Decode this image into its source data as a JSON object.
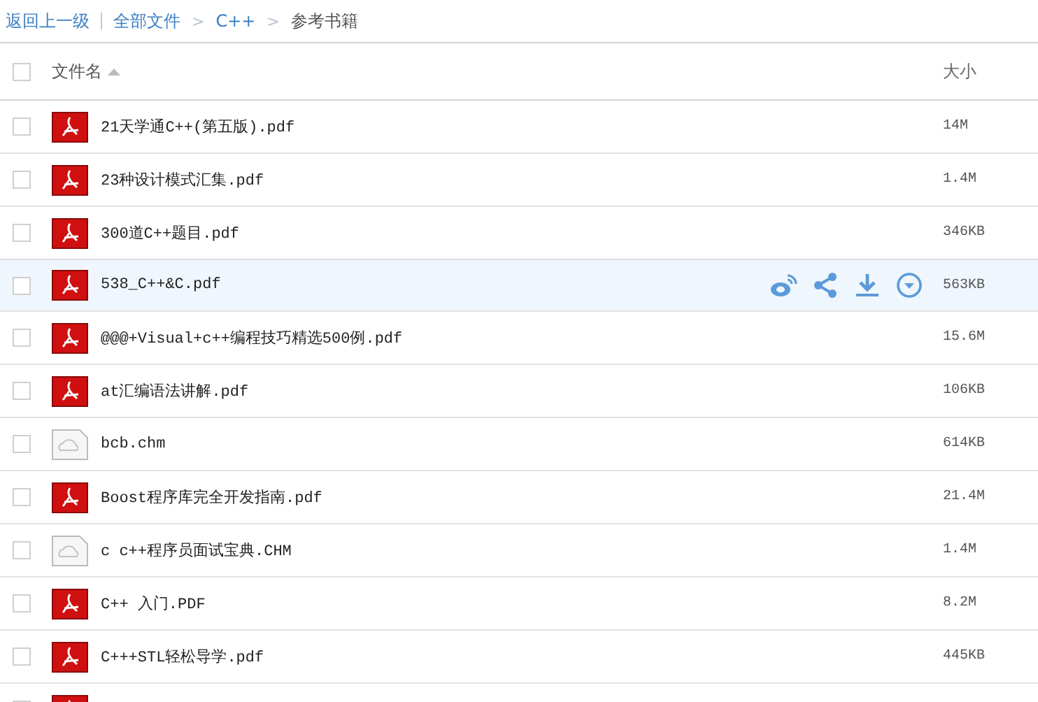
{
  "breadcrumb": {
    "back": "返回上一级",
    "items": [
      {
        "label": "全部文件",
        "current": false
      },
      {
        "label": "C++",
        "current": false
      },
      {
        "label": "参考书籍",
        "current": true
      }
    ],
    "separator": ">"
  },
  "table": {
    "columns": [
      {
        "label": "文件名",
        "sorted": true
      },
      {
        "label": "大小",
        "sorted": false
      }
    ],
    "header_checked": false,
    "rows": [
      {
        "kind": "pdf",
        "name": "21天学通C++(第五版).pdf",
        "size": "14M",
        "checked": false,
        "hovered": false
      },
      {
        "kind": "pdf",
        "name": "23种设计模式汇集.pdf",
        "size": "1.4M",
        "checked": false,
        "hovered": false
      },
      {
        "kind": "pdf",
        "name": "300道C++题目.pdf",
        "size": "346KB",
        "checked": false,
        "hovered": false
      },
      {
        "kind": "pdf",
        "name": "538_C++&C.pdf",
        "size": "563KB",
        "checked": false,
        "hovered": true
      },
      {
        "kind": "pdf",
        "name": "@@@+Visual+c++编程技巧精选500例.pdf",
        "size": "15.6M",
        "checked": false,
        "hovered": false
      },
      {
        "kind": "pdf",
        "name": "at汇编语法讲解.pdf",
        "size": "106KB",
        "checked": false,
        "hovered": false
      },
      {
        "kind": "cloud",
        "name": "bcb.chm",
        "size": "614KB",
        "checked": false,
        "hovered": false
      },
      {
        "kind": "pdf",
        "name": "Boost程序库完全开发指南.pdf",
        "size": "21.4M",
        "checked": false,
        "hovered": false
      },
      {
        "kind": "cloud",
        "name": "c c++程序员面试宝典.CHM",
        "size": "1.4M",
        "checked": false,
        "hovered": false
      },
      {
        "kind": "pdf",
        "name": "C++ 入门.PDF",
        "size": "8.2M",
        "checked": false,
        "hovered": false
      },
      {
        "kind": "pdf",
        "name": "C+++STL轻松导学.pdf",
        "size": "445KB",
        "checked": false,
        "hovered": false
      },
      {
        "kind": "pdf",
        "checked": false,
        "hovered": false
      }
    ]
  }
}
